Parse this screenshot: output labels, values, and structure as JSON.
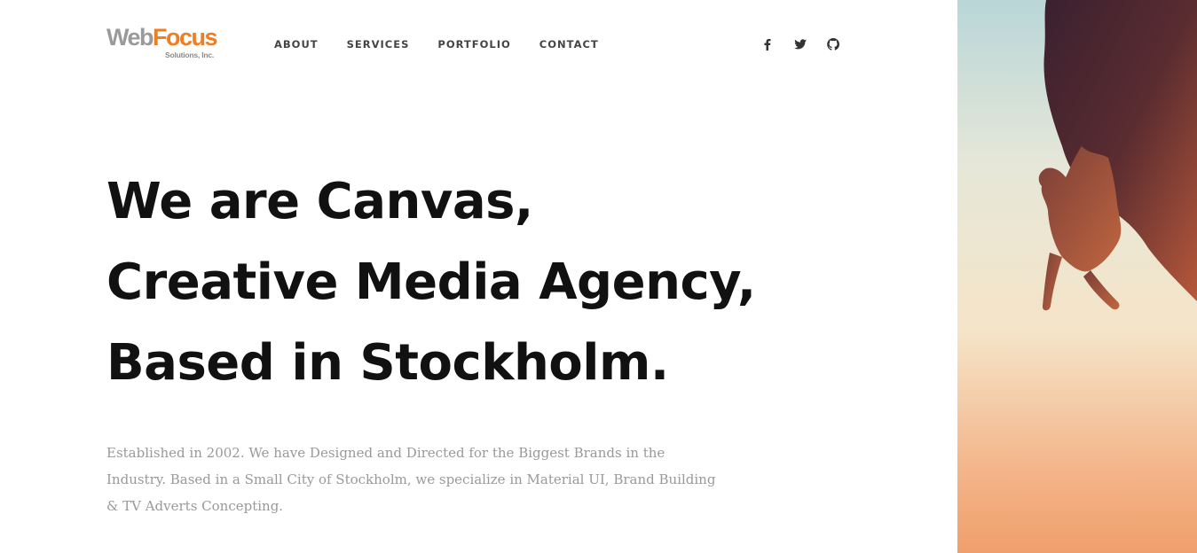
{
  "brand": {
    "logo_web": "Web",
    "logo_focus": "Focus",
    "logo_sub": "Solutions, Inc.",
    "color_web": "#9a9a9a",
    "color_focus": "#ef7d22"
  },
  "nav": {
    "items": [
      {
        "label": "ABOUT"
      },
      {
        "label": "SERVICES"
      },
      {
        "label": "PORTFOLIO"
      },
      {
        "label": "CONTACT"
      }
    ]
  },
  "social": {
    "icons": [
      "facebook-icon",
      "twitter-icon",
      "github-icon"
    ]
  },
  "hero": {
    "line1": "We are Canvas,",
    "line2": "Creative Media Agency,",
    "line3": "Based in Stockholm.",
    "description": "Established in 2002. We have Designed and Directed for the Biggest Brands in the Industry. Based in a Small City of Stockholm, we specialize in Material UI, Brand Building & TV Adverts Concepting.",
    "image": "rock-climber-silhouette-photo"
  },
  "colors": {
    "heading": "#111111",
    "body_text": "#999999",
    "nav_text": "#444444"
  }
}
